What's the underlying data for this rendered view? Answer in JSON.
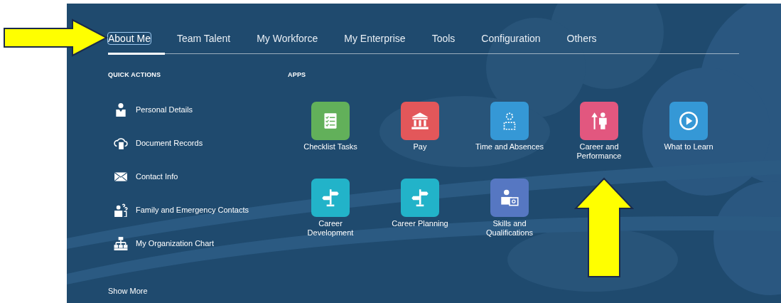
{
  "tabs": [
    {
      "label": "About Me",
      "selected": true
    },
    {
      "label": "Team Talent",
      "selected": false
    },
    {
      "label": "My Workforce",
      "selected": false
    },
    {
      "label": "My Enterprise",
      "selected": false
    },
    {
      "label": "Tools",
      "selected": false
    },
    {
      "label": "Configuration",
      "selected": false
    },
    {
      "label": "Others",
      "selected": false
    }
  ],
  "quick_actions": {
    "heading": "QUICK ACTIONS",
    "items": [
      {
        "label": "Personal Details"
      },
      {
        "label": "Document Records"
      },
      {
        "label": "Contact Info"
      },
      {
        "label": "Family and Emergency Contacts"
      },
      {
        "label": "My Organization Chart"
      }
    ],
    "show_more": "Show More"
  },
  "apps": {
    "heading": "APPS",
    "items": [
      {
        "label": "Checklist Tasks",
        "color": "#62b05a"
      },
      {
        "label": "Pay",
        "color": "#e3575a"
      },
      {
        "label": "Time and Absences",
        "color": "#3598d6"
      },
      {
        "label": "Career and Performance",
        "color": "#e2577f"
      },
      {
        "label": "What to Learn",
        "color": "#3598d6"
      },
      {
        "label": "Career Development",
        "color": "#22b3c9"
      },
      {
        "label": "Career Planning",
        "color": "#22b3c9"
      },
      {
        "label": "Skills and Qualifications",
        "color": "#5677c2"
      }
    ]
  }
}
